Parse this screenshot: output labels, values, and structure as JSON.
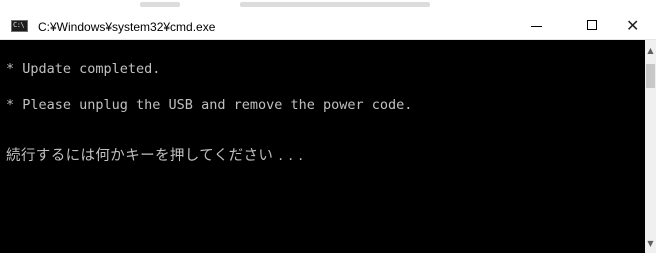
{
  "window": {
    "title": "C:¥Windows¥system32¥cmd.exe",
    "icon_text": "C:\\",
    "controls": {
      "minimize": "minimize-icon",
      "maximize": "maximize-icon",
      "close_label": "✕"
    }
  },
  "console": {
    "lines": [
      "* Update completed.",
      "* Please unplug the USB and remove the power code.",
      "続行するには何かキーを押してください . . ."
    ]
  },
  "scrollbar": {
    "up": "▲",
    "down": "▼"
  },
  "colors": {
    "console_bg": "#000000",
    "console_text": "#c0c0c0",
    "titlebar_bg": "#ffffff"
  }
}
